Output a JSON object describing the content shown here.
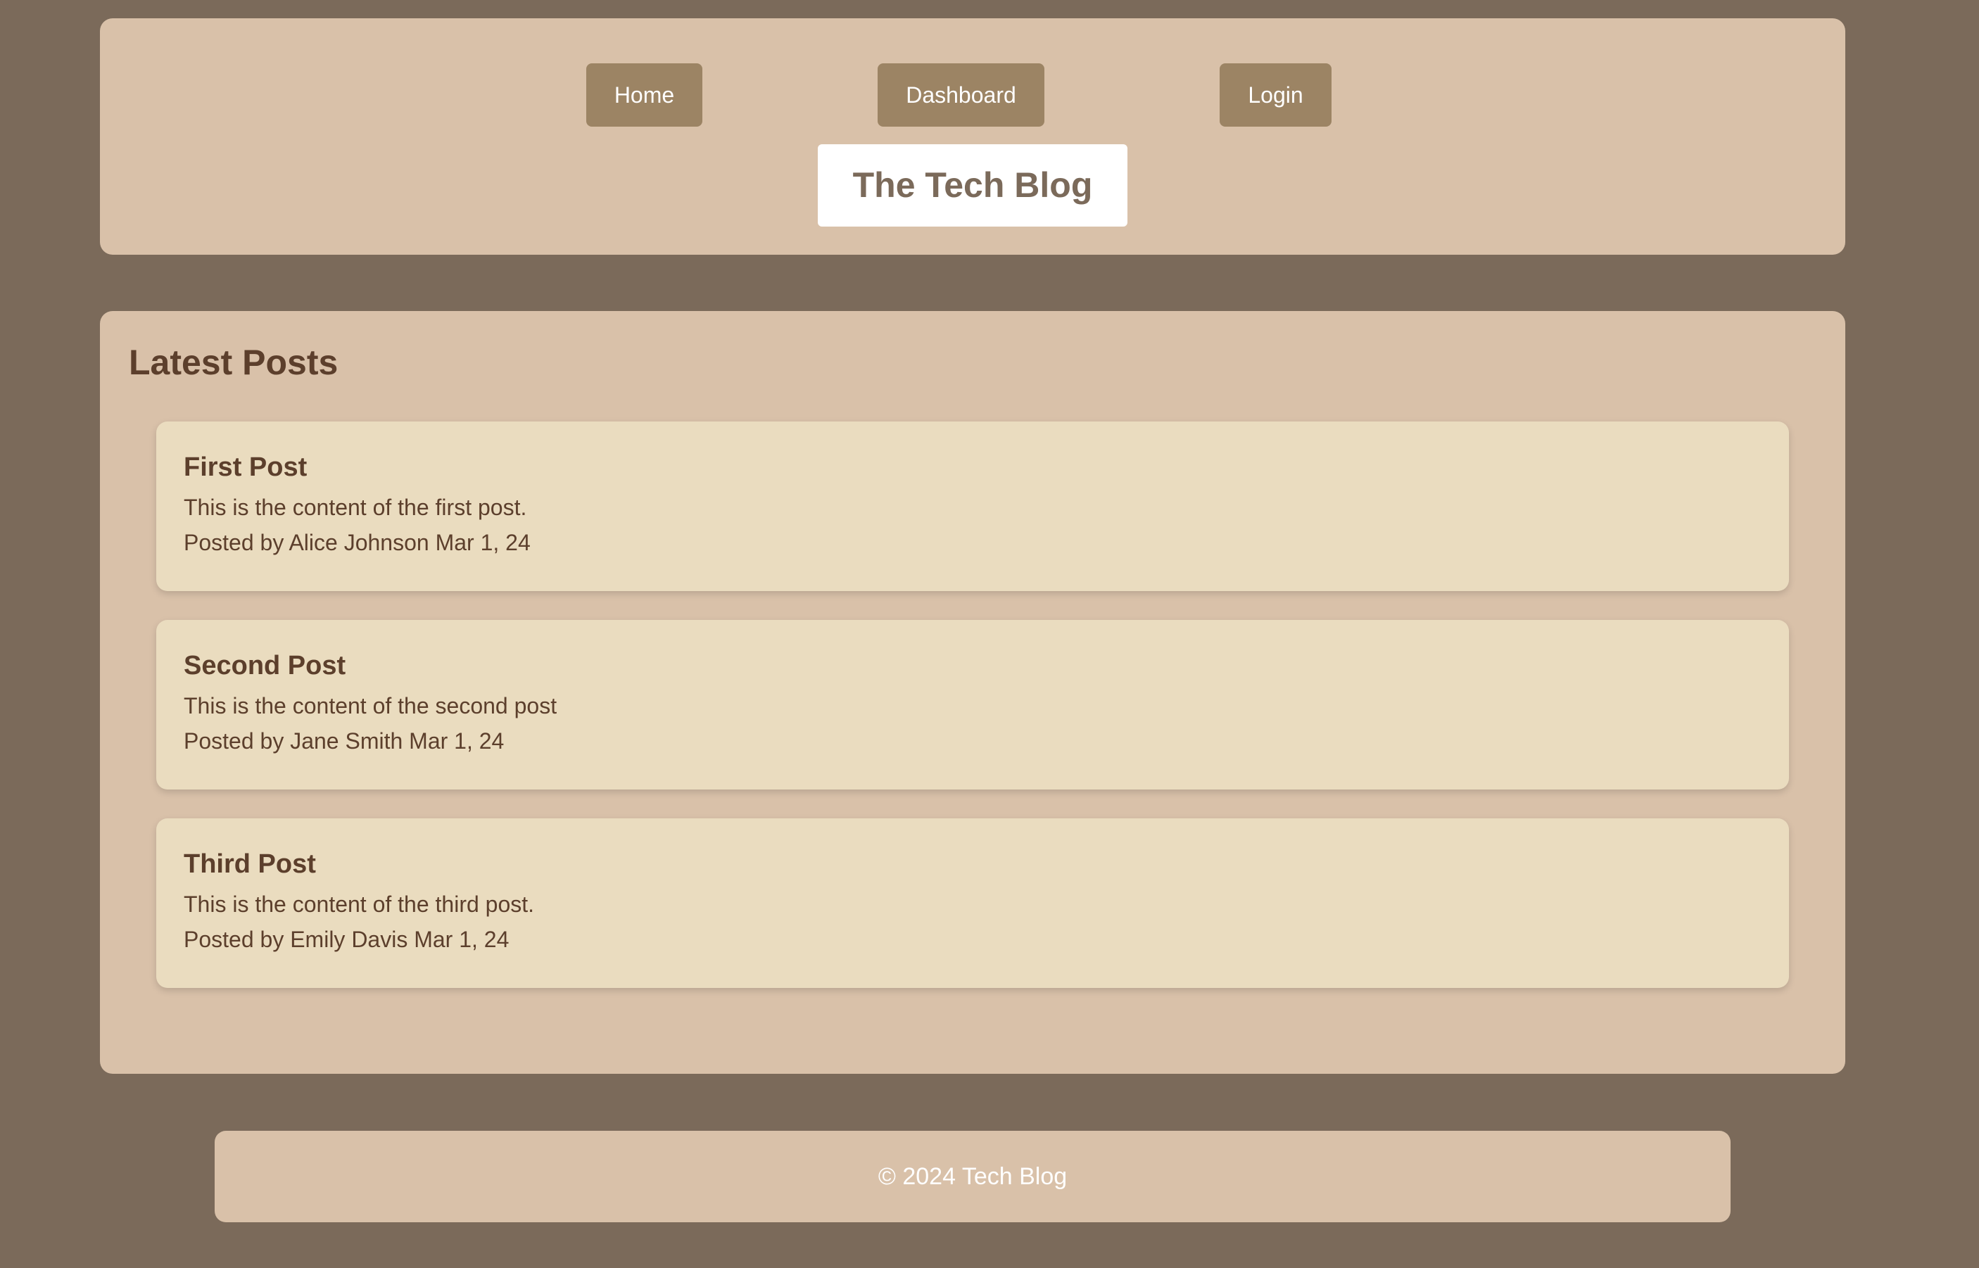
{
  "nav": {
    "home_label": "Home",
    "dashboard_label": "Dashboard",
    "login_label": "Login"
  },
  "site": {
    "title": "The Tech Blog"
  },
  "main": {
    "section_title": "Latest Posts",
    "posts": [
      {
        "title": "First Post",
        "content": "This is the content of the first post.",
        "meta": "Posted by Alice Johnson Mar 1, 24"
      },
      {
        "title": "Second Post",
        "content": "This is the content of the second post",
        "meta": "Posted by Jane Smith Mar 1, 24"
      },
      {
        "title": "Third Post",
        "content": "This is the content of the third post.",
        "meta": "Posted by Emily Davis Mar 1, 24"
      }
    ]
  },
  "footer": {
    "text": "© 2024 Tech Blog"
  },
  "colors": {
    "page_background": "#7b6a5a",
    "panel_background": "#d9c1a9",
    "card_background": "#eadcbf",
    "button_background": "#9c8464",
    "text_dark": "#5c3f2c"
  }
}
